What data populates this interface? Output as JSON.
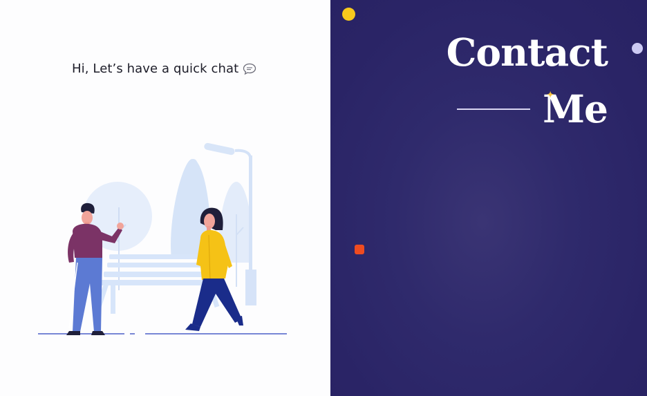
{
  "greeting": {
    "text": "Hi, Let’s have a quick chat",
    "icon": "speech-bubble-icon"
  },
  "illustration": {
    "name": "park-chat-illustration"
  },
  "title": {
    "line1": "Contact",
    "line2": "Me"
  },
  "colors": {
    "panel_bg": "#2b2566",
    "accent_yellow": "#f7c91c",
    "accent_red": "#ef4b20",
    "accent_lavender": "#ccc9f3",
    "title_text": "#ffffff"
  }
}
